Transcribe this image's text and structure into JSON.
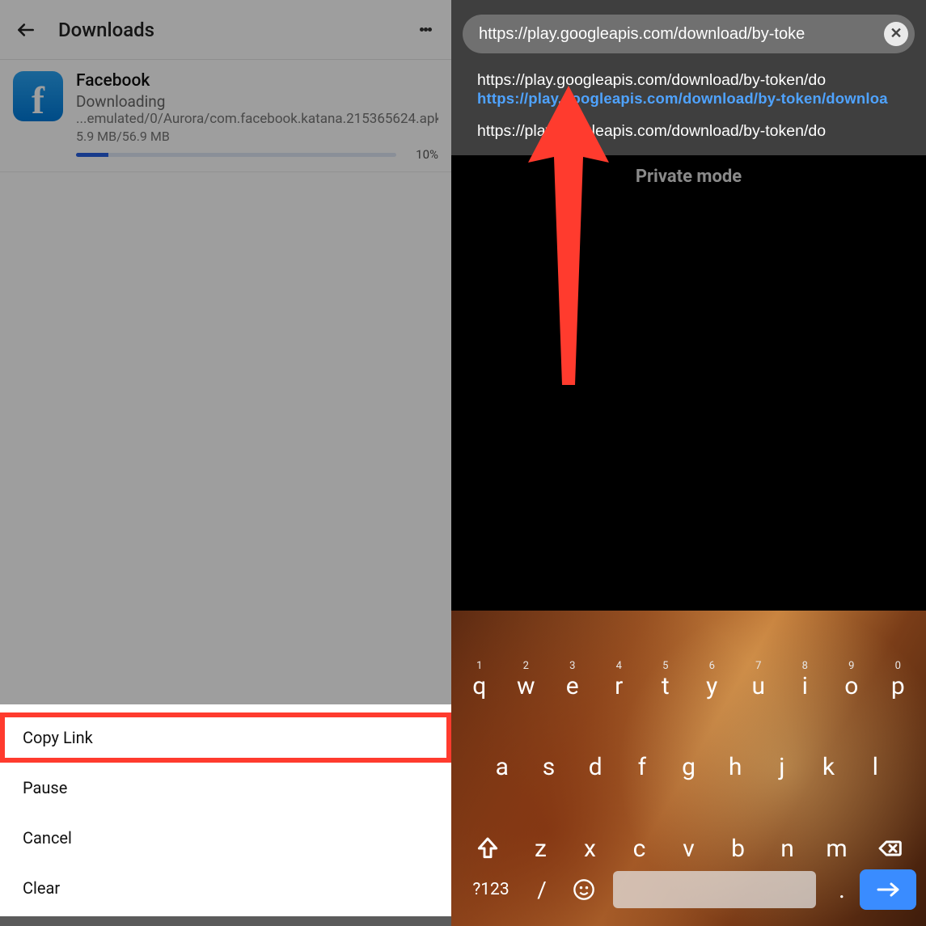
{
  "left": {
    "header_title": "Downloads",
    "download": {
      "name": "Facebook",
      "status": "Downloading",
      "path": "...emulated/0/Aurora/com.facebook.katana.215365624.apk",
      "size": "5.9 MB/56.9 MB",
      "percent": "10%"
    },
    "sheet": {
      "copy_link": "Copy Link",
      "pause": "Pause",
      "cancel": "Cancel",
      "clear": "Clear"
    }
  },
  "right": {
    "address": "https://play.googleapis.com/download/by-toke",
    "suggestions": {
      "line1": "https://play.googleapis.com/download/by-token/do",
      "line2": "https://play.googleapis.com/download/by-token/downloa",
      "line3": "https://play.googleapis.com/download/by-token/do"
    },
    "private_label": "Private mode",
    "keyboard": {
      "row1": [
        {
          "ch": "q",
          "sup": "1"
        },
        {
          "ch": "w",
          "sup": "2"
        },
        {
          "ch": "e",
          "sup": "3"
        },
        {
          "ch": "r",
          "sup": "4"
        },
        {
          "ch": "t",
          "sup": "5"
        },
        {
          "ch": "y",
          "sup": "6"
        },
        {
          "ch": "u",
          "sup": "7"
        },
        {
          "ch": "i",
          "sup": "8"
        },
        {
          "ch": "o",
          "sup": "9"
        },
        {
          "ch": "p",
          "sup": "0"
        }
      ],
      "row2": [
        "a",
        "s",
        "d",
        "f",
        "g",
        "h",
        "j",
        "k",
        "l"
      ],
      "row3": [
        "z",
        "x",
        "c",
        "v",
        "b",
        "n",
        "m"
      ],
      "sym": "?123",
      "slash": "/",
      "dot": "."
    }
  }
}
